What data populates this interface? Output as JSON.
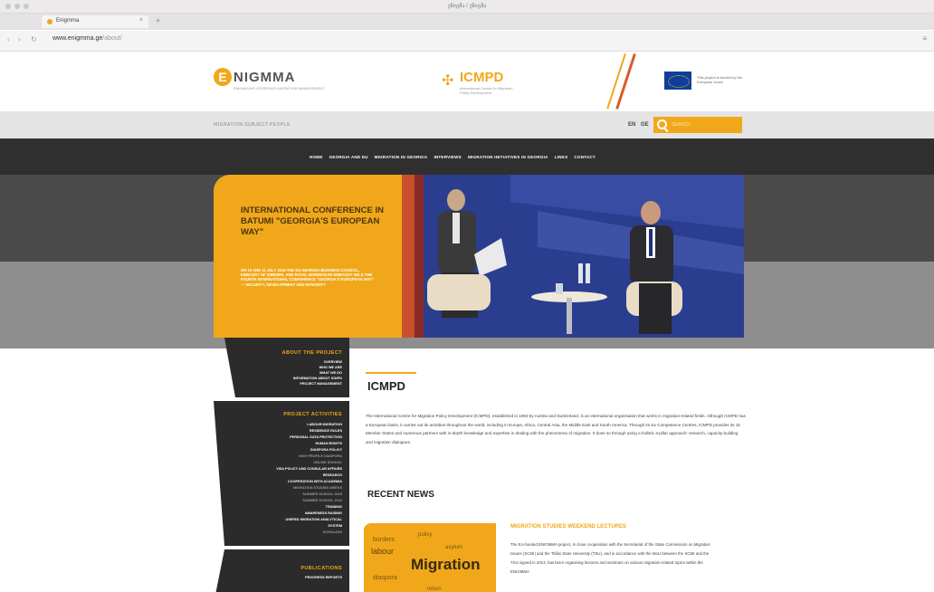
{
  "browser": {
    "window_title": "ენიგმა / ენიგმა",
    "tab_label": "Enigmma",
    "tab_close": "×",
    "new_tab": "+",
    "url_host": "www.enigmma.ge",
    "url_path": "/about/",
    "back": "‹",
    "forward": "›",
    "reload": "↻",
    "menu": "≡"
  },
  "header": {
    "enigmma_letter": "E",
    "enigmma_name": "NIGMMA",
    "enigmma_sub": "ENHANCING GEORGIA'S MIGRATION MANAGEMENT",
    "icmpd_name": "ICMPD",
    "icmpd_sub": "International Centre for Migration Policy Development",
    "eu_text": "This project is funded by the European Union",
    "tagline": "MIGRATION.SUBJECT.PEOPLE",
    "lang_en": "EN",
    "lang_ge": "GE",
    "search_placeholder": "SEARCH"
  },
  "nav": {
    "items": [
      "HOME",
      "GEORGIA AND EU",
      "MIGRATION IN GEORGIA",
      "INTERVIEWS",
      "MIGRATION INITIATIVES IN GEORGIA",
      "LINKS",
      "CONTACT"
    ]
  },
  "hero": {
    "title": "INTERNATIONAL CONFERENCE IN BATUMI \"GEORGIA'S EUROPEAN WAY\"",
    "description": "ON 10 AND 11 JULY 2016 THE EU-GEORGIA BUSINESS COUNCIL, EMBASSY OF SWEDEN, AND ROYAL NORWEGIAN EMBASSY HELD THE FOURTH INTERNATIONAL CONFERENCE \"GEORGIA'S EUROPEAN WAY\" — SECURITY, DEVELOPMENT AND INTEGRITY"
  },
  "sidebar": {
    "about": {
      "heading": "ABOUT THE PROJECT",
      "items": [
        "OVERVIEW",
        "WHO WE ARE",
        "WHAT WE DO",
        "INFORMATION ABOUT ICMPD",
        "PROJECT MANAGEMENT"
      ]
    },
    "activities": {
      "heading": "PROJECT ACTIVITIES",
      "items": [
        {
          "label": "LABOUR MIGRATION",
          "muted": false
        },
        {
          "label": "RESIDENCE RULES",
          "muted": false
        },
        {
          "label": "PERSONAL DATA PROTECTION",
          "muted": false
        },
        {
          "label": "HUMAN RIGHTS",
          "muted": false
        },
        {
          "label": "DIASPORA POLICY",
          "muted": false
        },
        {
          "label": "HIGH PROFILE DIASPORA",
          "muted": true
        },
        {
          "label": "ONLINE SCHOOL",
          "muted": true
        },
        {
          "label": "VISA POLICY AND CONSULAR AFFAIRS",
          "muted": false
        },
        {
          "label": "RESEARCH",
          "muted": false
        },
        {
          "label": "COOPERATION WITH ACADEMIA",
          "muted": false
        },
        {
          "label": "MIGRATION STUDIES WEEKS",
          "muted": true
        },
        {
          "label": "SUMMER SCHOOL 2015",
          "muted": true
        },
        {
          "label": "SUMMER SCHOOL 2016",
          "muted": true
        },
        {
          "label": "TRAINING",
          "muted": false
        },
        {
          "label": "AWARENESS RAISING",
          "muted": false
        },
        {
          "label": "UNIFIED MIGRATION ANALYTICAL",
          "muted": false
        },
        {
          "label": "SYSTEM",
          "muted": false
        },
        {
          "label": "SCHOLARS",
          "muted": true
        }
      ]
    },
    "publications": {
      "heading": "PUBLICATIONS",
      "items": [
        "PROGRESS REPORTS"
      ]
    }
  },
  "main": {
    "icmpd_title": "ICMPD",
    "intro": "The International Centre for Migration Policy Development (ICMPD), established in 1993 by Austria and Switzerland, is an international organisation that works in migration-related fields. Although ICMPD has a European basis, it carries out its activities throughout the world, including in Europe, Africa, Central Asia, the Middle East and South America. Through its six Competence Centres, ICMPD provides its 15 Member States and numerous partners with in-depth knowledge and expertise in dealing with the phenomena of migration. It does so through using a holistic 3-pillar approach: research, capacity building and migration dialogues.",
    "news_heading": "RECENT NEWS",
    "news_thumb_word": "Migration",
    "news_title": "MIGRATION STUDIES WEEKEND LECTURES",
    "news_excerpt": "The EU-funded ENIGMMA project, in close cooperation with the Secretariat of the State Commission on Migration Issues (SCMI) and the Tbilisi State University (TSU), and in accordance with the MoU between the SCMI and the TSU signed in 2013, has been organising lectures and seminars on various migration-related topics within the ENIGMMA"
  },
  "colors": {
    "accent": "#f0a81a",
    "dark": "#2b2b2b",
    "nav": "#2f2f2f"
  }
}
